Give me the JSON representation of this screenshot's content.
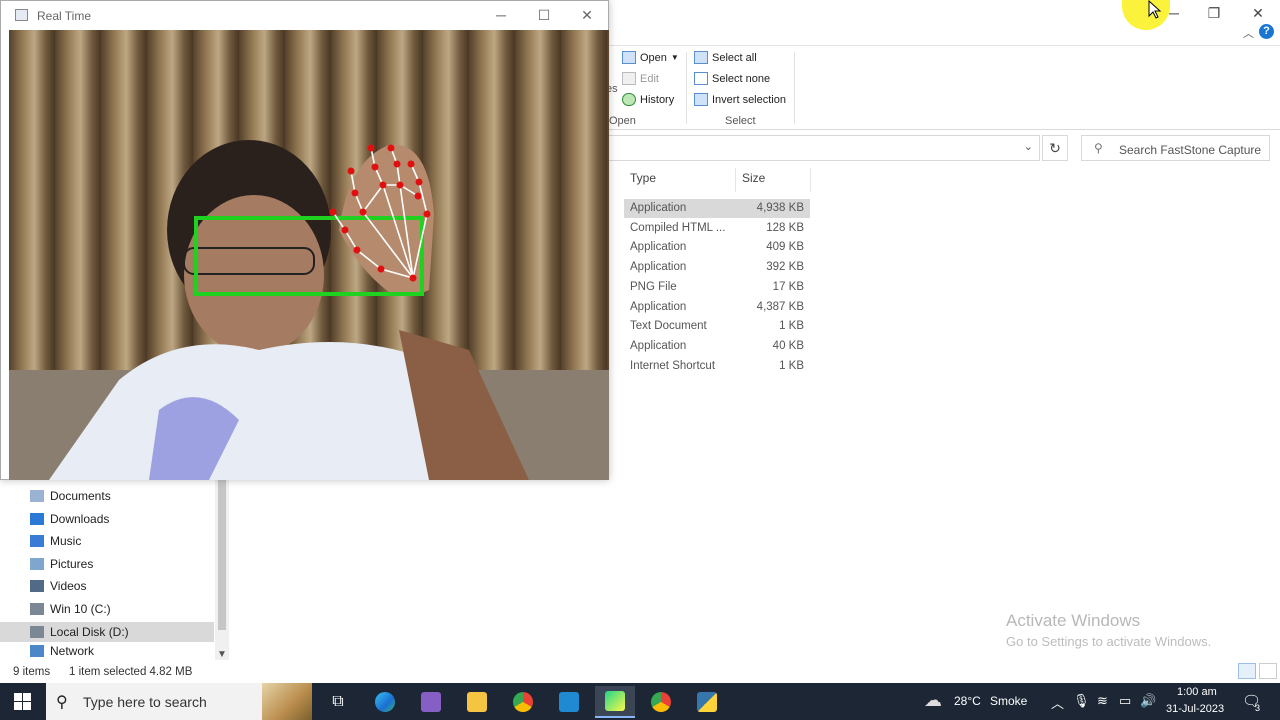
{
  "explorer": {
    "ribbon": {
      "open_label": "Open",
      "edit_label": "Edit",
      "history_label": "History",
      "open_group": "Open",
      "select_all": "Select all",
      "select_none": "Select none",
      "invert_selection": "Invert selection",
      "select_group": "Select",
      "cut_text": "es"
    },
    "search_placeholder": "Search FastStone Capture",
    "columns": {
      "type": "Type",
      "size": "Size"
    },
    "files": [
      {
        "type": "Application",
        "size": "4,938 KB",
        "selected": true
      },
      {
        "type": "Compiled HTML ...",
        "size": "128 KB"
      },
      {
        "type": "Application",
        "size": "409 KB"
      },
      {
        "type": "Application",
        "size": "392 KB"
      },
      {
        "type": "PNG File",
        "size": "17 KB"
      },
      {
        "type": "Application",
        "size": "4,387 KB"
      },
      {
        "type": "Text Document",
        "size": "1 KB"
      },
      {
        "type": "Application",
        "size": "40 KB"
      },
      {
        "type": "Internet Shortcut",
        "size": "1 KB"
      }
    ],
    "nav": [
      {
        "label": "Documents",
        "icon": "documents-icon"
      },
      {
        "label": "Downloads",
        "icon": "downloads-icon"
      },
      {
        "label": "Music",
        "icon": "music-icon"
      },
      {
        "label": "Pictures",
        "icon": "pictures-icon"
      },
      {
        "label": "Videos",
        "icon": "videos-icon"
      },
      {
        "label": "Win 10 (C:)",
        "icon": "drive-icon"
      },
      {
        "label": "Local Disk (D:)",
        "icon": "drive-icon",
        "active": true
      },
      {
        "label": "Network",
        "icon": "network-icon"
      }
    ],
    "status": {
      "items": "9 items",
      "selection": "1 item selected  4.82 MB"
    },
    "watermark": {
      "line1": "Activate Windows",
      "line2": "Go to Settings to activate Windows."
    }
  },
  "realtime_window": {
    "title": "Real Time",
    "accent_box_color": "#1fd21f",
    "landmark_color": "#e01010"
  },
  "taskbar": {
    "search_placeholder": "Type here to search",
    "weather": {
      "temp": "28°C",
      "condition": "Smoke"
    },
    "clock": {
      "time": "1:00 am",
      "date": "31-Jul-2023"
    },
    "notification_count": "3",
    "apps": [
      "task-view",
      "edge",
      "visual-studio",
      "file-explorer",
      "chrome",
      "vscode",
      "pycharm",
      "chrome-profile",
      "python"
    ]
  }
}
